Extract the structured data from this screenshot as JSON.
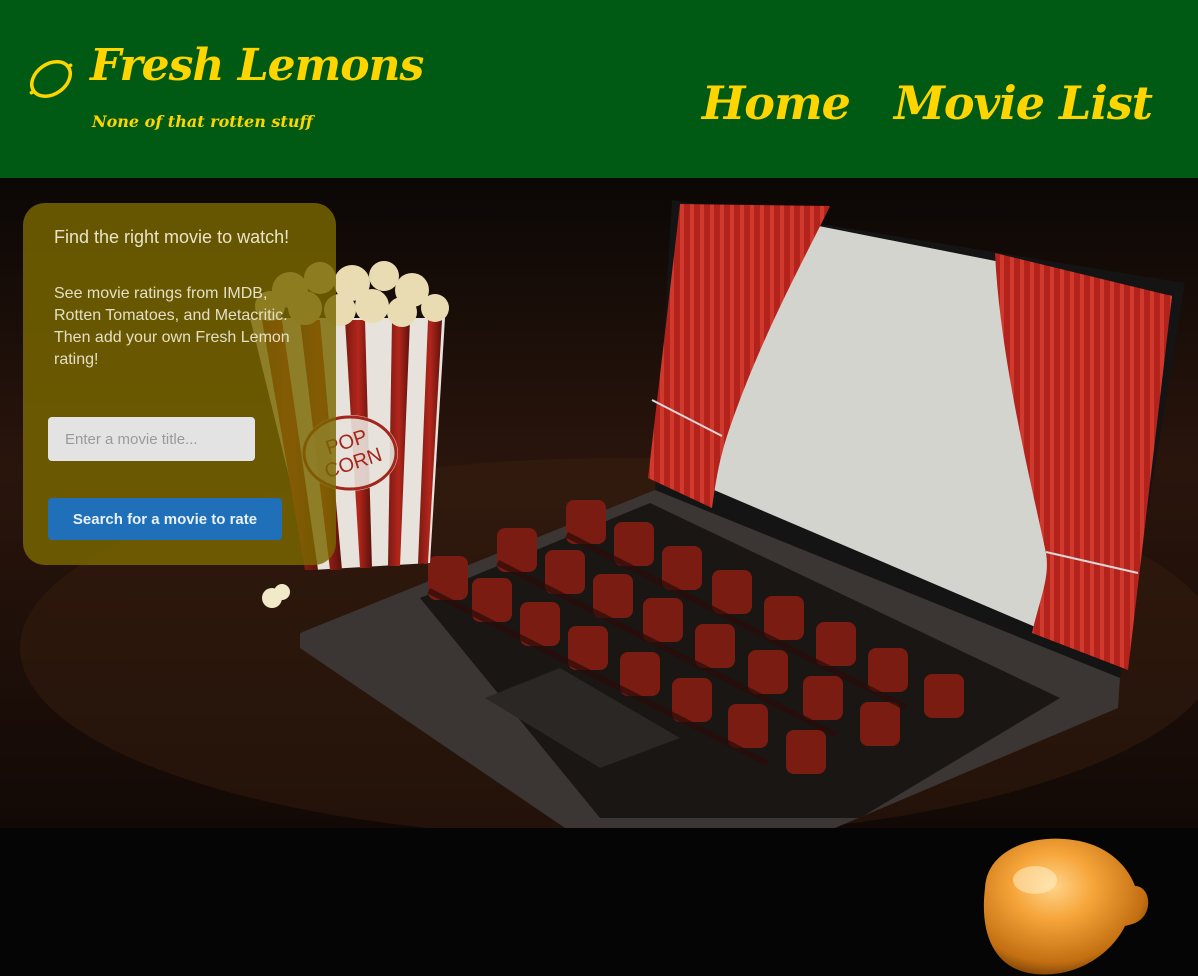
{
  "header": {
    "brand_title": "Fresh Lemons",
    "brand_tagline": "None of that rotten stuff",
    "logo_icon": "lemon-outline-icon",
    "nav": [
      {
        "label": "Home"
      },
      {
        "label": "Movie List"
      }
    ]
  },
  "hero": {
    "image": "laptop-movie-theater-with-popcorn",
    "card": {
      "heading": "Find the right movie to watch!",
      "text": "See movie ratings from IMDB, Rotten Tomatoes, and Metacritic. Then add your own Fresh Lemon rating!",
      "search_placeholder": "Enter a movie title...",
      "search_value": "",
      "button_label": "Search for a movie to rate"
    }
  },
  "footer": {
    "image": "lemon-photo"
  },
  "colors": {
    "header_bg": "#005a14",
    "accent_yellow": "#ffd500",
    "card_bg": "rgba(122,104,0,0.82)",
    "button_blue": "#1f70b8"
  }
}
